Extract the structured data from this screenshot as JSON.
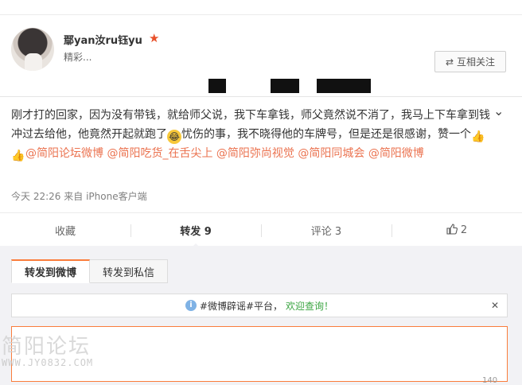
{
  "header": {
    "username": "鄢yan汝ru钰yu",
    "subtitle": "精彩...",
    "follow_label": "互相关注",
    "verify_icon": "star-icon"
  },
  "post": {
    "text_part1": "刚才打的回家，因为没有带钱，就给师父说，我下车拿钱，师父竟然说不消了，我马上下车拿到钱冲过去给他，他竟然开起就跑了",
    "text_part2": "忧伤的事，我不晓得他的车牌号，但是还是很感谢，赞一个",
    "mentions": [
      "@简阳论坛微博",
      "@简阳吃货_在舌尖上",
      "@简阳弥尚视觉",
      "@简阳同城会",
      "@简阳微博"
    ],
    "time": "今天 22:26",
    "from_label": "来自",
    "client": "iPhone客户端"
  },
  "actions": [
    {
      "label": "收藏"
    },
    {
      "label": "转发 9"
    },
    {
      "label": "评论 3"
    },
    {
      "label": "2",
      "icon": "thumbs-up-icon"
    }
  ],
  "forward_panel": {
    "tabs": [
      "转发到微博",
      "转发到私信"
    ],
    "notice_prefix": "#微博辟谣#平台，",
    "notice_link": "欢迎查询！",
    "watermark_cn": "简阳论坛",
    "watermark_url": "WWW.JY0832.COM",
    "counter": "140"
  },
  "colors": {
    "accent": "#eb7350",
    "link_green": "#3aa541",
    "focus_border": "#fa7d3c"
  }
}
